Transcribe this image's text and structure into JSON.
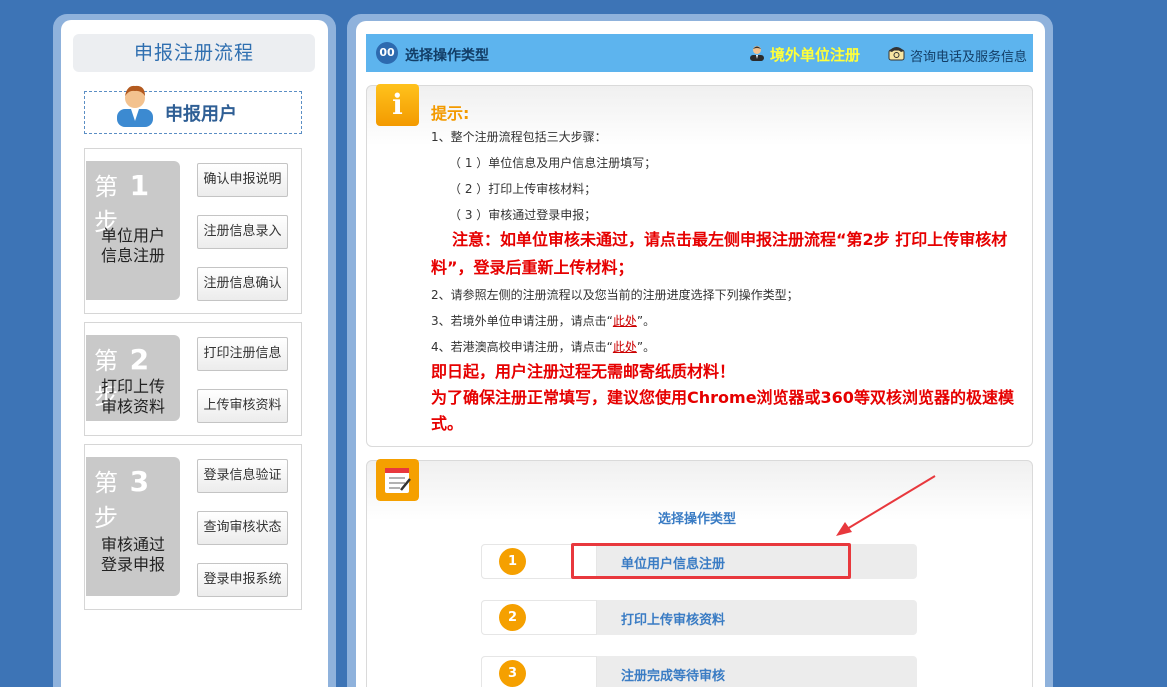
{
  "left": {
    "title": "申报注册流程",
    "user_label": "申报用户",
    "steps": [
      {
        "num_prefix": "第",
        "num": "1",
        "num_suffix": "步",
        "text_line1": "单位用户",
        "text_line2": "信息注册",
        "buttons": [
          "确认申报说明",
          "注册信息录入",
          "注册信息确认"
        ]
      },
      {
        "num_prefix": "第",
        "num": "2",
        "num_suffix": "步",
        "text_line1": "打印上传",
        "text_line2": "审核资料",
        "buttons": [
          "打印注册信息",
          "上传审核资料"
        ]
      },
      {
        "num_prefix": "第",
        "num": "3",
        "num_suffix": "步",
        "text_line1": "审核通过",
        "text_line2": "登录申报",
        "buttons": [
          "登录信息验证",
          "查询审核状态",
          "登录申报系统"
        ]
      }
    ]
  },
  "header": {
    "badge": "00",
    "title": "选择操作类型",
    "register_link": "境外单位注册",
    "consult_link": "咨询电话及服务信息"
  },
  "tips": {
    "icon_glyph": "i",
    "title": "提示:",
    "line1": "1、整个注册流程包括三大步骤：",
    "sub1": "（ 1 ）单位信息及用户信息注册填写；",
    "sub2": "（ 2 ）打印上传审核材料；",
    "sub3": "（ 3 ）审核通过登录申报；",
    "notice_line1": "注意：如单位审核未通过，请点击最左侧申报注册流程“第2步 打印上传审核材",
    "notice_line2": "料”，登录后重新上传材料；",
    "line2": "2、请参照左侧的注册流程以及您当前的注册进度选择下列操作类型；",
    "line3_pre": "3、若境外单位申请注册，请点击“",
    "line3_link": "此处",
    "line3_post": "”。",
    "line4_pre": "4、若港澳高校申请注册，请点击“",
    "line4_link": "此处",
    "line4_post": "”。",
    "red1": "即日起，用户注册过程无需邮寄纸质材料！",
    "red2_line1": "为了确保注册正常填写，建议您使用Chrome浏览器或360等双核浏览器的极速模",
    "red2_line2": "式。"
  },
  "operations": {
    "title": "选择操作类型",
    "items": [
      {
        "num": "1",
        "label": "单位用户信息注册"
      },
      {
        "num": "2",
        "label": "打印上传审核资料"
      },
      {
        "num": "3",
        "label": "注册完成等待审核"
      }
    ]
  },
  "colors": {
    "background": "#3d74b6",
    "header_bar": "#5db4ee",
    "accent_orange": "#f5a000",
    "notice_red": "#e60000",
    "highlight_red": "#e8383d",
    "register_yellow": "#ffff3a"
  }
}
